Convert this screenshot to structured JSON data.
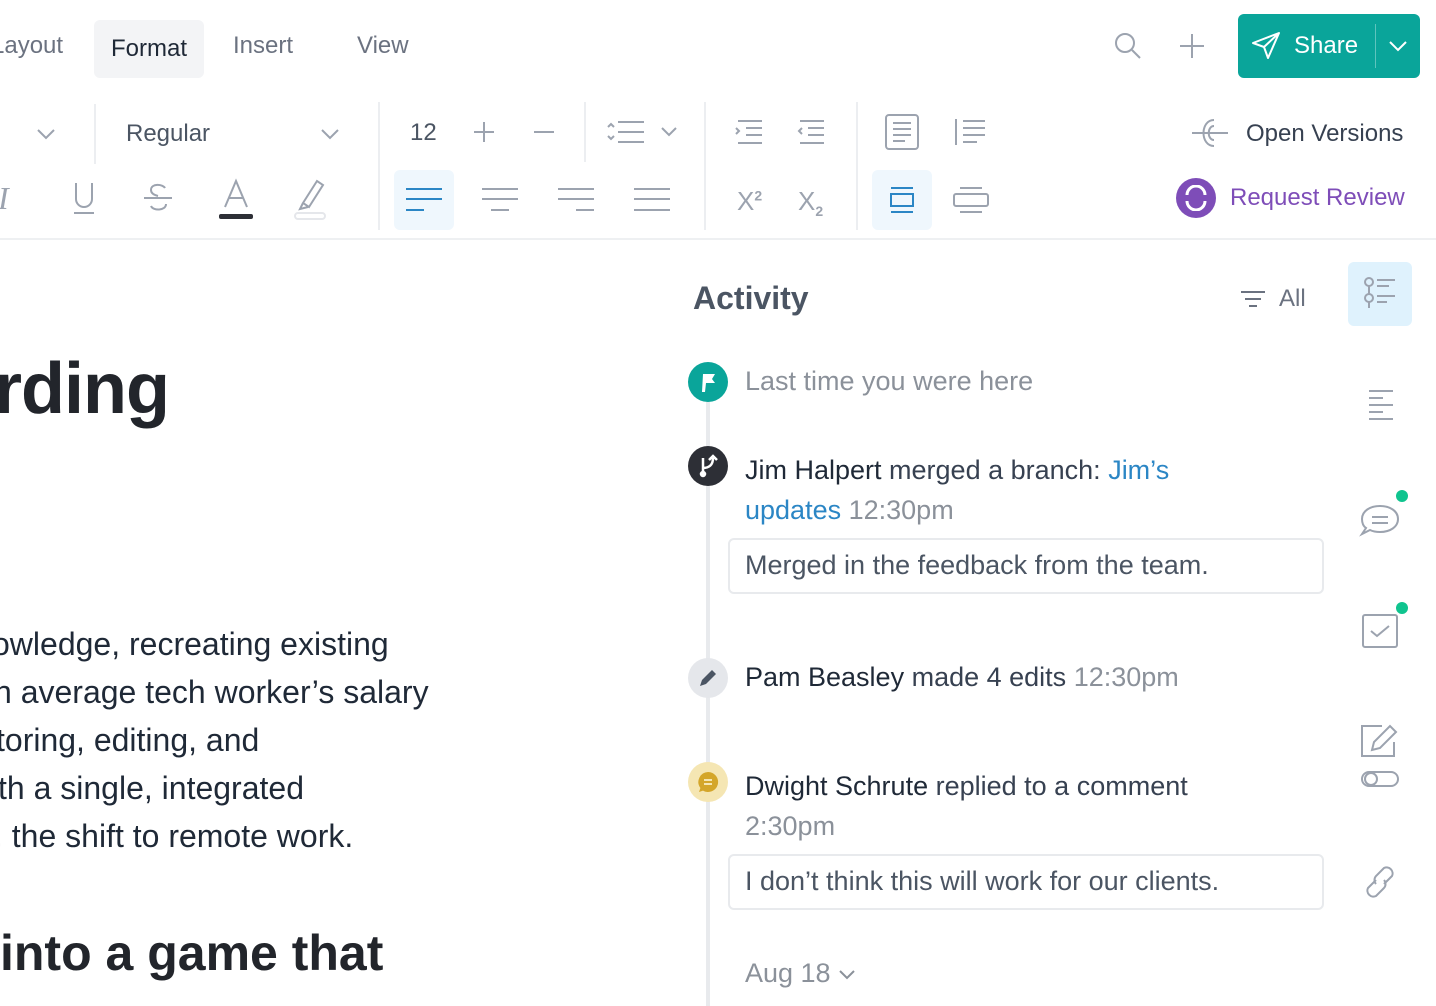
{
  "menu": {
    "items": [
      "Layout",
      "Format",
      "Insert",
      "View"
    ],
    "active": "Format"
  },
  "header": {
    "share_label": "Share"
  },
  "toolbar": {
    "font_weight": "Regular",
    "font_size": "12",
    "superscript": "2",
    "subscript": "2",
    "open_versions": "Open Versions",
    "request_review": "Request Review"
  },
  "document": {
    "heading": "rding",
    "paragraph_lines": [
      "owledge, recreating existing",
      "n average tech worker’s salary",
      "toring, editing, and",
      "th a single, integrated",
      ", the shift to remote work."
    ],
    "subheading": "into a game that"
  },
  "activity": {
    "title": "Activity",
    "filter_label": "All",
    "last_time": "Last time you were here",
    "items": [
      {
        "user": "Jim Halpert",
        "action": "merged a branch:",
        "link": "Jim’s updates",
        "time": "12:30pm",
        "comment": "Merged in the feedback from the team."
      },
      {
        "user": "Pam Beasley",
        "action": "made 4 edits",
        "time": "12:30pm"
      },
      {
        "user": "Dwight Schrute",
        "action": "replied to a comment",
        "time": "2:30pm",
        "comment": "I don’t think this will work for our clients."
      }
    ],
    "date_group": "Aug 18"
  },
  "colors": {
    "accent": "#0aa59a",
    "primary_blue": "#2b86c5",
    "review_purple": "#7e4db8",
    "notification": "#10c48f"
  }
}
